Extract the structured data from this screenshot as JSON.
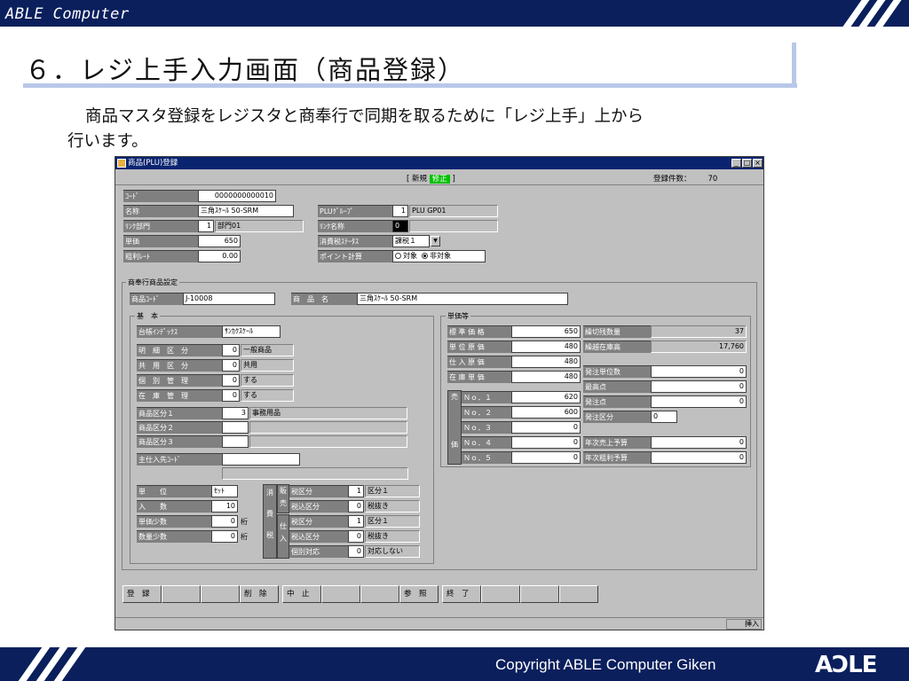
{
  "slide": {
    "brand": "ABLE Computer",
    "title": "６．レジ上手入力画面（商品登録）",
    "desc_line1": "商品マスタ登録をレジスタと商奉行で同期を取るために「レジ上手」上から",
    "desc_line2": "行います。",
    "copyright": "Copyright  ABLE  Computer  Giken",
    "logo": "AƆLE"
  },
  "window": {
    "title": "商品(PLU)登録",
    "mode_new": "新規",
    "mode_fix": "修正",
    "count_label": "登録件数：",
    "count_value": "70",
    "min": "_",
    "max": "□",
    "close": "×"
  },
  "top": {
    "code_label": "ｺｰﾄﾞ",
    "code_value": "0000000000010",
    "name_label": "名称",
    "name_value": "三角ｽｹｰﾙ 50-SRM",
    "link_dept_label": "ﾘﾝｸ部門",
    "link_dept_no": "1",
    "link_dept_name": "部門01",
    "price_label": "単価",
    "price_value": "650",
    "margin_label": "粗利ﾚｰﾄ",
    "margin_value": "0.00",
    "plu_group_label": "PLUｸﾞﾙｰﾌﾟ",
    "plu_group_no": "1",
    "plu_group_name": "PLU GP01",
    "link_name_label": "ﾘﾝｸ名称",
    "link_name_value": "0",
    "tax_status_label": "消費税ｽﾃｰﾀｽ",
    "tax_status_value": "課税１",
    "point_label": "ポイント計算",
    "point_opt1": "対象",
    "point_opt2": "非対象"
  },
  "bugyo": {
    "group_label": "商奉行商品設定",
    "code_label": "商品ｺｰﾄﾞ",
    "code_value": "J-10008",
    "name_label": "商　品　名",
    "name_value": "三角ｽｹｰﾙ 50-SRM",
    "basic_label": "基　本",
    "index_label": "台帳ｲﾝﾃﾞｯｸｽ",
    "index_value": "ｻﾝｶｸｽｹｰﾙ",
    "rows": [
      {
        "label": "明　細　区　分",
        "no": "0",
        "text": "一般商品"
      },
      {
        "label": "共　用　区　分",
        "no": "0",
        "text": "共用"
      },
      {
        "label": "個　別　管　理",
        "no": "0",
        "text": "する"
      },
      {
        "label": "在　庫　管　理",
        "no": "0",
        "text": "する"
      }
    ],
    "cat1_label": "商品区分１",
    "cat1_no": "3",
    "cat1_text": "事務用品",
    "cat2_label": "商品区分２",
    "cat3_label": "商品区分３",
    "supplier_label": "主仕入先ｺｰﾄﾞ",
    "unit_label": "単　　位",
    "unit_value": "ｾｯﾄ",
    "qty_label": "入　　数",
    "qty_value": "10",
    "price_dec_label": "単価少数",
    "price_dec_value": "0",
    "price_dec_unit": "桁",
    "qty_dec_label": "数量少数",
    "qty_dec_value": "0",
    "qty_dec_unit": "桁",
    "tax_v1": "消",
    "tax_v2": "費",
    "tax_v3": "税",
    "sale_v": "販売",
    "buy_v": "仕入",
    "tax_rows": [
      {
        "label": "税区分",
        "no": "1",
        "text": "区分１"
      },
      {
        "label": "税込区分",
        "no": "0",
        "text": "税抜き"
      },
      {
        "label": "税区分",
        "no": "1",
        "text": "区分１"
      },
      {
        "label": "税込区分",
        "no": "0",
        "text": "税抜き"
      },
      {
        "label": "個別対応",
        "no": "0",
        "text": "対応しない"
      }
    ],
    "prices_label": "単価等",
    "prices": [
      {
        "label": "標 準 価 格",
        "value": "650"
      },
      {
        "label": "単 位 原 価",
        "value": "480"
      },
      {
        "label": "仕 入 原 価",
        "value": "480"
      },
      {
        "label": "在 庫 単 価",
        "value": "480"
      }
    ],
    "sell_v1": "売",
    "sell_v2": "価",
    "sells": [
      {
        "label": "Ｎｏ．１",
        "value": "620"
      },
      {
        "label": "Ｎｏ．２",
        "value": "600"
      },
      {
        "label": "Ｎｏ．３",
        "value": "0"
      },
      {
        "label": "Ｎｏ．４",
        "value": "0"
      },
      {
        "label": "Ｎｏ．５",
        "value": "0"
      }
    ],
    "right_rows": [
      {
        "label": "繰切残数量",
        "value": "37"
      },
      {
        "label": "繰越在庫高",
        "value": "17,760"
      }
    ],
    "order_unit_label": "発注単位数",
    "order_unit_value": "0",
    "max_label": "最高点",
    "max_value": "0",
    "order_point_label": "発注点",
    "order_point_value": "0",
    "order_cat_label": "発注区分",
    "order_cat_value": "0",
    "annual_sales_label": "年次売上予算",
    "annual_sales_value": "0",
    "annual_profit_label": "年次粗利予算",
    "annual_profit_value": "0"
  },
  "buttons": {
    "register": "登　録",
    "delete": "削　除",
    "cancel": "中　止",
    "refer": "参　照",
    "end": "終　了"
  },
  "status": {
    "ins": "挿入"
  }
}
